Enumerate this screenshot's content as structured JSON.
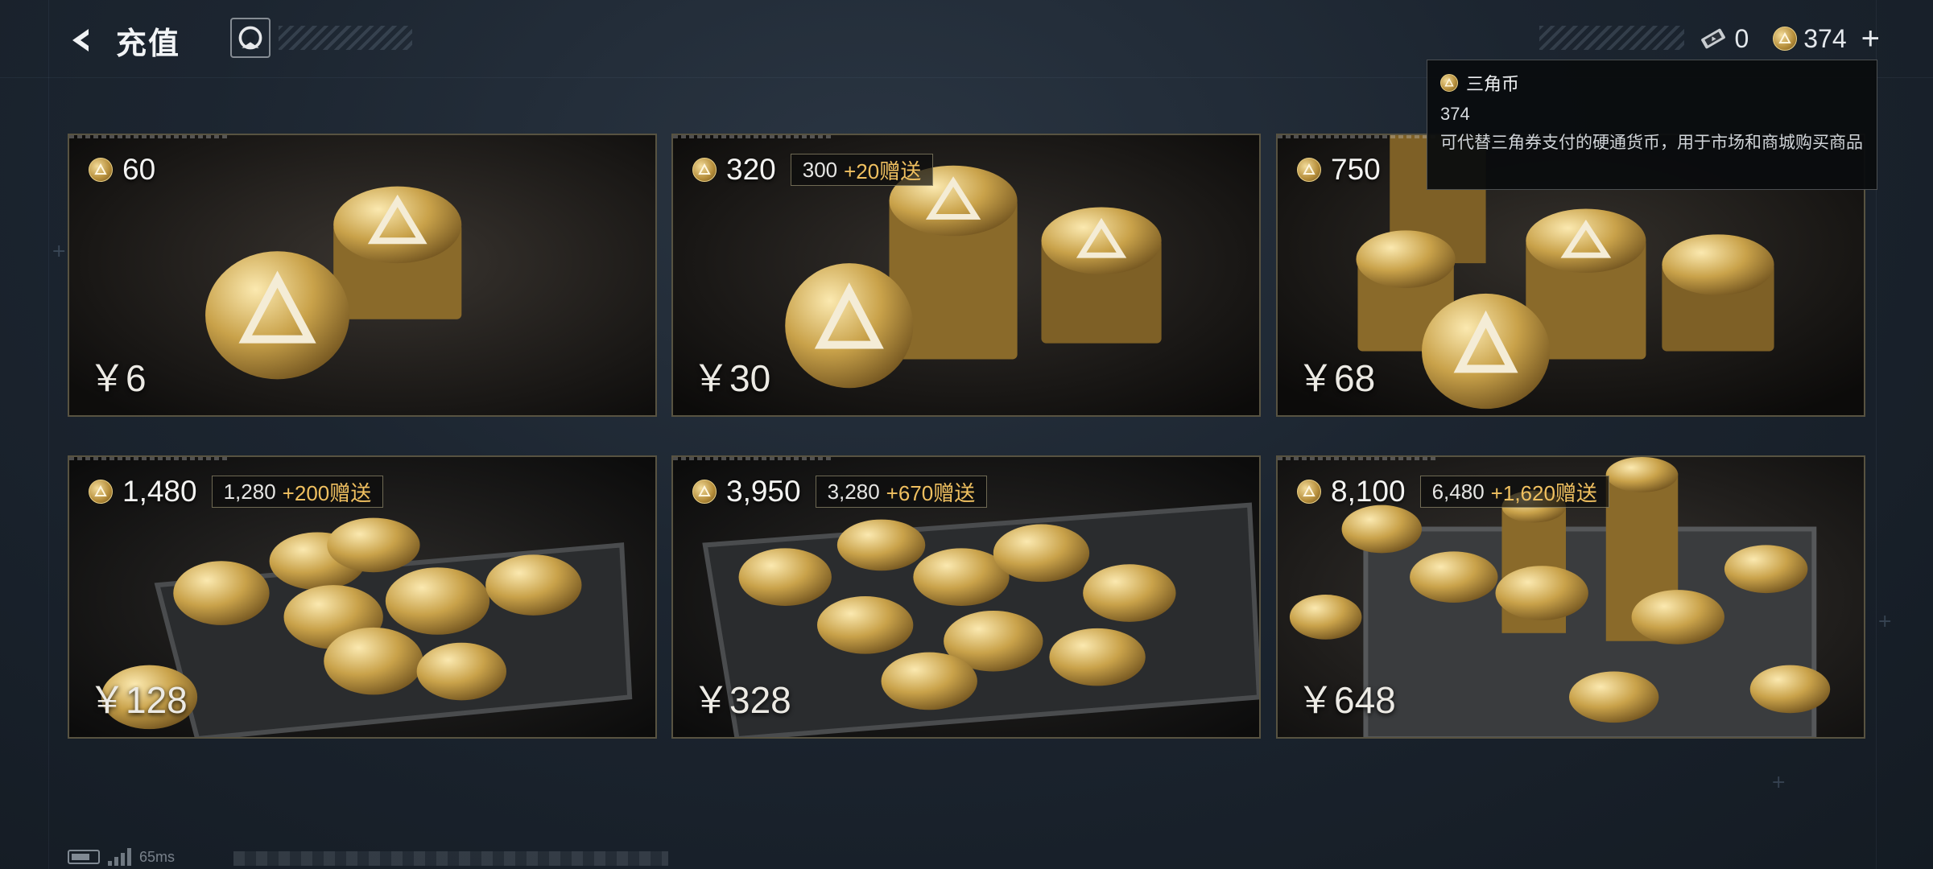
{
  "header": {
    "title": "充值"
  },
  "currency_bar": {
    "ticket_count": "0",
    "coin_count": "374",
    "plus": "+"
  },
  "tooltip": {
    "name": "三角币",
    "value": "374",
    "description": "可代替三角券支付的硬通货币，用于市场和商城购买商品"
  },
  "packages": [
    {
      "amount": "60",
      "bonus_base": "",
      "bonus_extra": "",
      "price": "￥6"
    },
    {
      "amount": "320",
      "bonus_base": "300",
      "bonus_extra": "+20赠送",
      "price": "￥30"
    },
    {
      "amount": "750",
      "bonus_base": "",
      "bonus_extra": "",
      "price": "￥68"
    },
    {
      "amount": "1,480",
      "bonus_base": "1,280",
      "bonus_extra": "+200赠送",
      "price": "￥128"
    },
    {
      "amount": "3,950",
      "bonus_base": "3,280",
      "bonus_extra": "+670赠送",
      "price": "￥328"
    },
    {
      "amount": "8,100",
      "bonus_base": "6,480",
      "bonus_extra": "+1,620赠送",
      "price": "￥648"
    }
  ],
  "status_bar": {
    "latency": "65ms"
  },
  "colors": {
    "background": "#1a222c",
    "gold": "#d4b060",
    "bonus_accent": "#f0c060"
  }
}
